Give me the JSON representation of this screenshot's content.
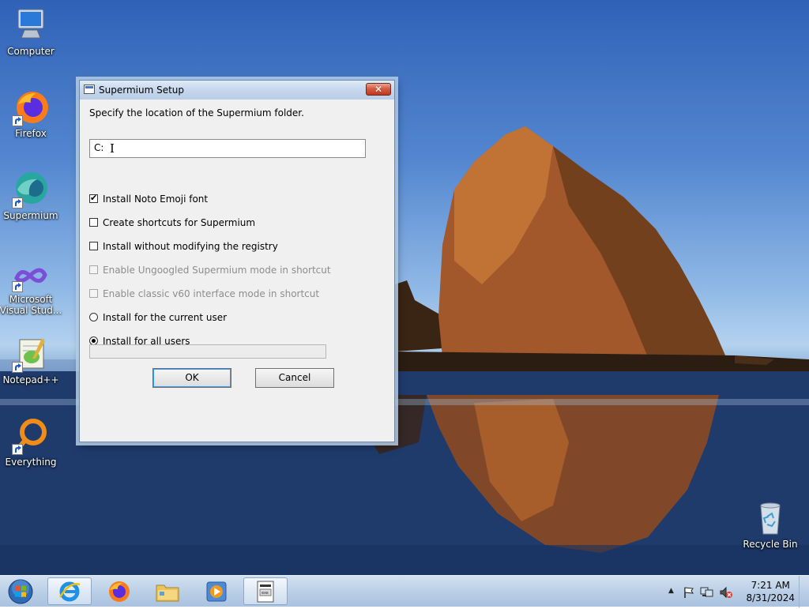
{
  "desktop": {
    "icons": [
      {
        "label": "Computer",
        "icon": "computer-icon"
      },
      {
        "label": "Firefox",
        "icon": "firefox-icon"
      },
      {
        "label": "Supermium",
        "icon": "supermium-icon"
      },
      {
        "label": "Microsoft Visual Stud...",
        "label_line1": "Microsoft",
        "label_line2": "Visual Stud...",
        "icon": "visual-studio-icon"
      },
      {
        "label": "Notepad++",
        "icon": "notepadpp-icon"
      },
      {
        "label": "Everything",
        "icon": "everything-icon"
      },
      {
        "label": "Recycle Bin",
        "icon": "recycle-bin-icon"
      }
    ]
  },
  "dialog": {
    "title": "Supermium Setup",
    "close_symbol": "✕",
    "instruction": "Specify the location of the Supermium folder.",
    "path_value": "C:",
    "options": {
      "noto_emoji": {
        "label": "Install Noto Emoji font",
        "checked": true,
        "enabled": true
      },
      "shortcuts": {
        "label": "Create shortcuts for Supermium",
        "checked": false,
        "enabled": true
      },
      "no_registry": {
        "label": "Install without modifying the registry",
        "checked": false,
        "enabled": true
      },
      "ungoogled": {
        "label": "Enable Ungoogled Supermium mode in shortcut",
        "checked": false,
        "enabled": false
      },
      "classic_v60": {
        "label": "Enable classic v60 interface mode in shortcut",
        "checked": false,
        "enabled": false
      }
    },
    "install_scope": {
      "current_user": {
        "label": "Install for the current user",
        "selected": false
      },
      "all_users": {
        "label": "Install for all users",
        "selected": true
      }
    },
    "progress": 0,
    "ok_label": "OK",
    "cancel_label": "Cancel"
  },
  "taskbar": {
    "pinned": [
      "internet-explorer-icon",
      "firefox-icon",
      "file-explorer-icon",
      "media-player-icon",
      "setup-app-icon"
    ],
    "active_index": 0,
    "clock": {
      "time": "7:21 AM",
      "date": "8/31/2024"
    },
    "tray_icons": [
      "show-hidden-icons-chevron-icon",
      "action-center-flag-icon",
      "network-icon",
      "volume-muted-icon"
    ]
  }
}
